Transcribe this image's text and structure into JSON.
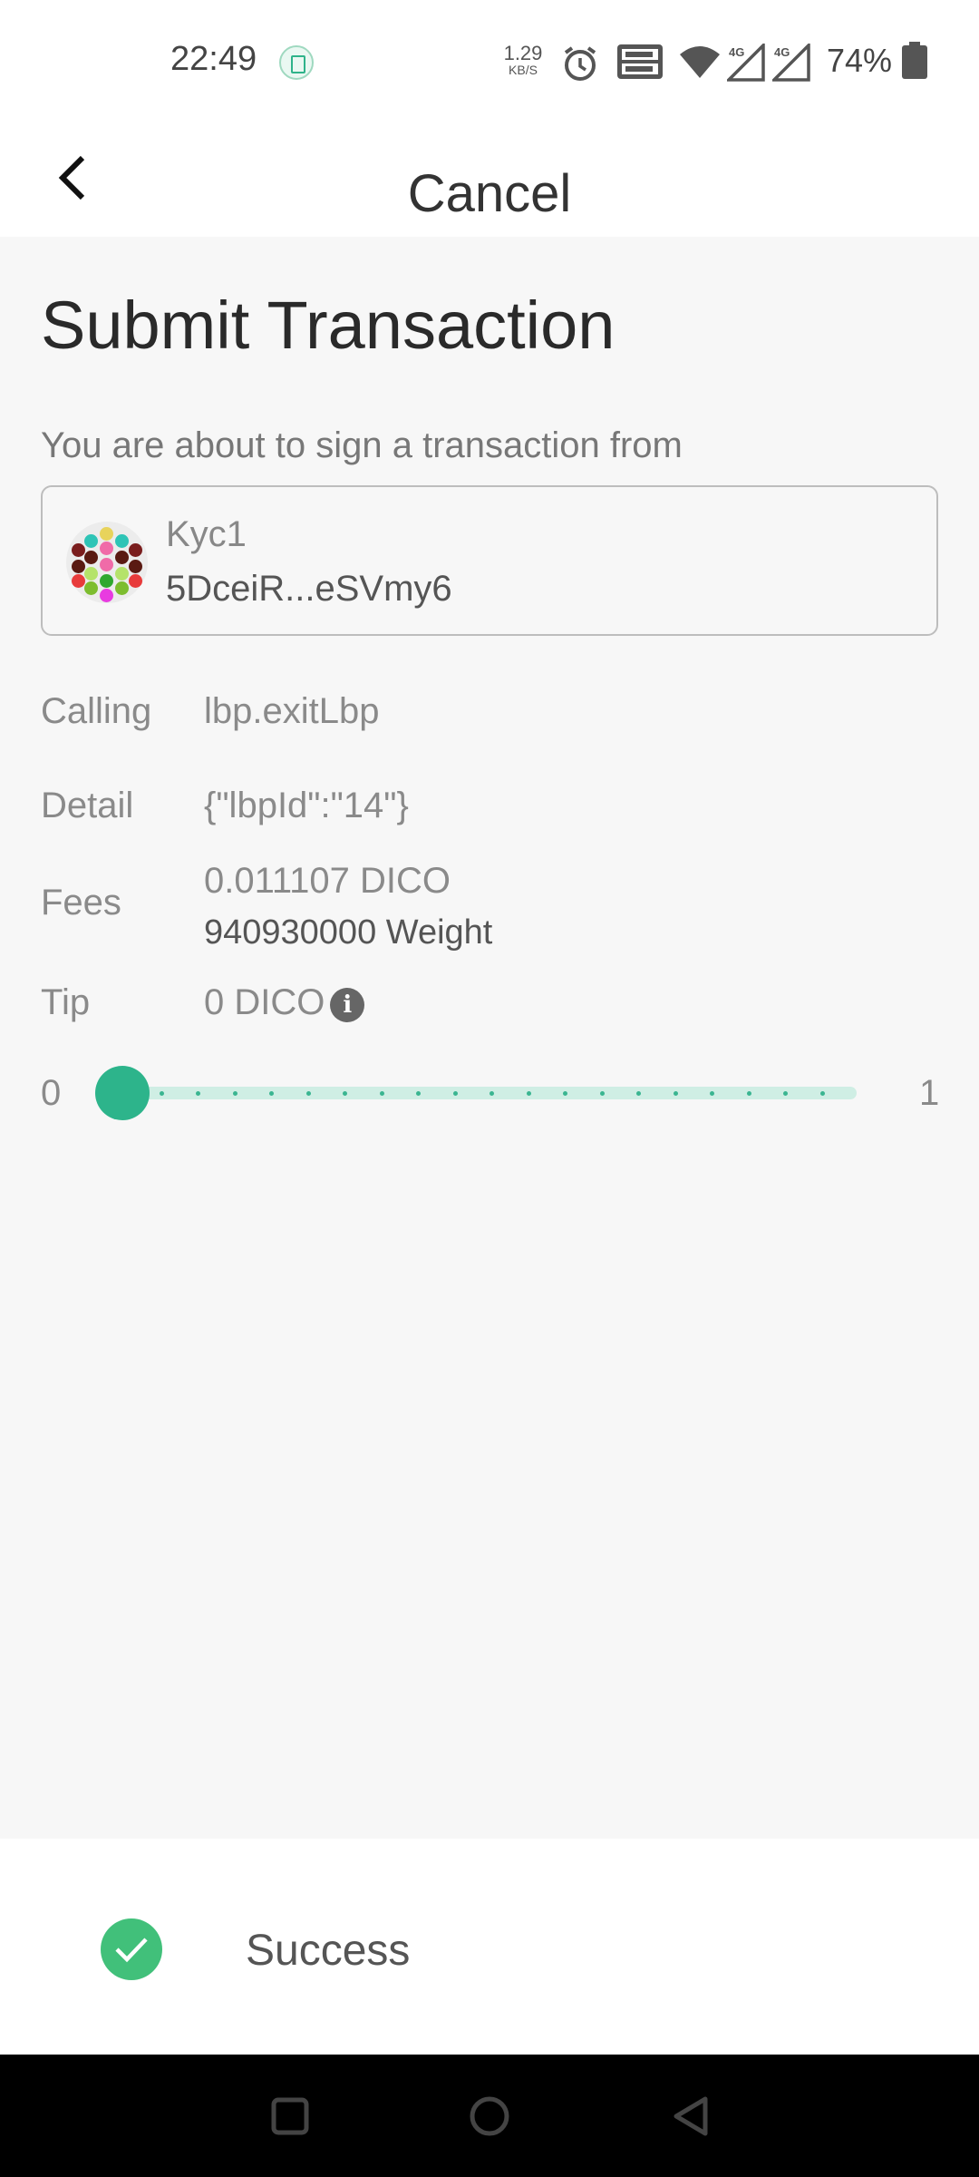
{
  "status_bar": {
    "time": "22:49",
    "speed_value": "1.29",
    "speed_unit": "KB/S",
    "battery_percent": "74%",
    "icons": [
      "app-notification-icon",
      "alarm-icon",
      "volte-icon",
      "wifi-icon",
      "signal-4g-icon",
      "signal-4g-icon",
      "battery-icon"
    ]
  },
  "header": {
    "back_icon": "chevron-left-icon",
    "title": "Cancel"
  },
  "page": {
    "title": "Submit Transaction",
    "sign_label": "You are about to sign a transaction from"
  },
  "account": {
    "name": "Kyc1",
    "address": "5DceiR...eSVmy6"
  },
  "details": {
    "calling_label": "Calling",
    "calling_value": "lbp.exitLbp",
    "detail_label": "Detail",
    "detail_value": "{\"lbpId\":\"14\"}",
    "fees_label": "Fees",
    "fees_value": "0.011107 DICO",
    "weight_value": "940930000 Weight",
    "tip_label": "Tip",
    "tip_value": "0 DICO",
    "tip_info_icon": "info-icon"
  },
  "tip_slider": {
    "min_label": "0",
    "max_label": "1",
    "value": 0,
    "steps": 20
  },
  "toast": {
    "icon": "check-circle-icon",
    "message": "Success"
  },
  "nav_bar": {
    "icons": [
      "recents-square-icon",
      "home-circle-icon",
      "back-triangle-icon"
    ]
  },
  "colors": {
    "accent": "#2db48b",
    "success": "#41c07a",
    "background": "#f7f7f7"
  }
}
